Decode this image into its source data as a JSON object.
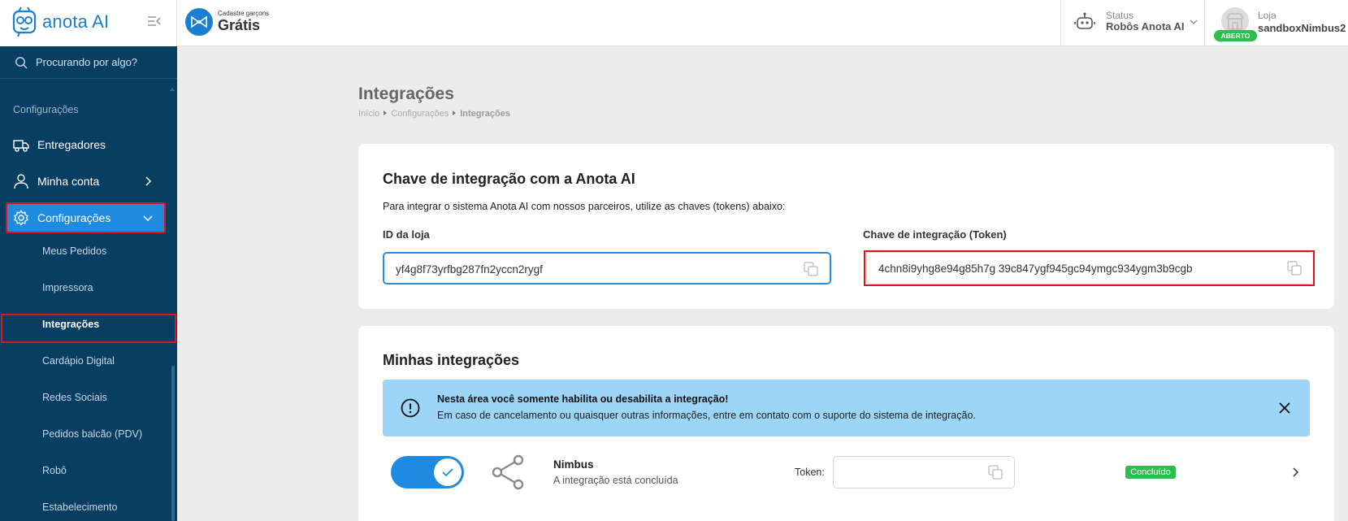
{
  "brand": {
    "name": "anota AI"
  },
  "sidebar": {
    "search_placeholder": "Procurando por algo?",
    "section_label": "Configurações",
    "items": [
      {
        "label": "Entregadores"
      },
      {
        "label": "Minha conta"
      },
      {
        "label": "Configurações"
      }
    ],
    "sub_items": [
      {
        "label": "Meus Pedidos"
      },
      {
        "label": "Impressora"
      },
      {
        "label": "Integrações"
      },
      {
        "label": "Cardápio Digital"
      },
      {
        "label": "Redes Sociais"
      },
      {
        "label": "Pedidos balcão (PDV)"
      },
      {
        "label": "Robô"
      },
      {
        "label": "Estabelecimento"
      }
    ]
  },
  "topbar": {
    "promo_small": "Cadastre garçons",
    "promo_big": "Grátis",
    "status_label": "Status",
    "status_value": "Robôs Anota AI",
    "store_label": "Loja",
    "store_value": "sandboxNimbus2",
    "store_badge": "ABERTO"
  },
  "page": {
    "title": "Integrações",
    "breadcrumb": [
      "Início",
      "Configurações",
      "Integrações"
    ]
  },
  "key_card": {
    "title": "Chave de integração com a Anota AI",
    "description": "Para integrar o sistema Anota AI com nossos parceiros, utilize as chaves (tokens) abaixo:",
    "store_id_label": "ID da loja",
    "store_id_value": "yf4g8f73yrfbg287fn2yccn2rygf",
    "token_label": "Chave de integração (Token)",
    "token_value": "4chn8i9yhg8e94g85h7g 39c847ygf945gc94ymgc934ygm3b9cgb"
  },
  "integrations_card": {
    "title": "Minhas integrações",
    "banner_title": "Nesta área você somente habilita ou desabilita a integração!",
    "banner_text": "Em caso de cancelamento ou quaisquer outras informações, entre em contato com o suporte do sistema de integração.",
    "items": [
      {
        "name": "Nimbus",
        "status_text": "A integração está concluída",
        "token_label": "Token:",
        "token_value": "",
        "badge": "Concluído",
        "enabled": true
      }
    ]
  },
  "colors": {
    "sidebar_bg": "#093e63",
    "accent": "#1f8be0",
    "success": "#2dbf4e",
    "highlight": "#e0121a",
    "info_bg": "#9cd5f7"
  }
}
